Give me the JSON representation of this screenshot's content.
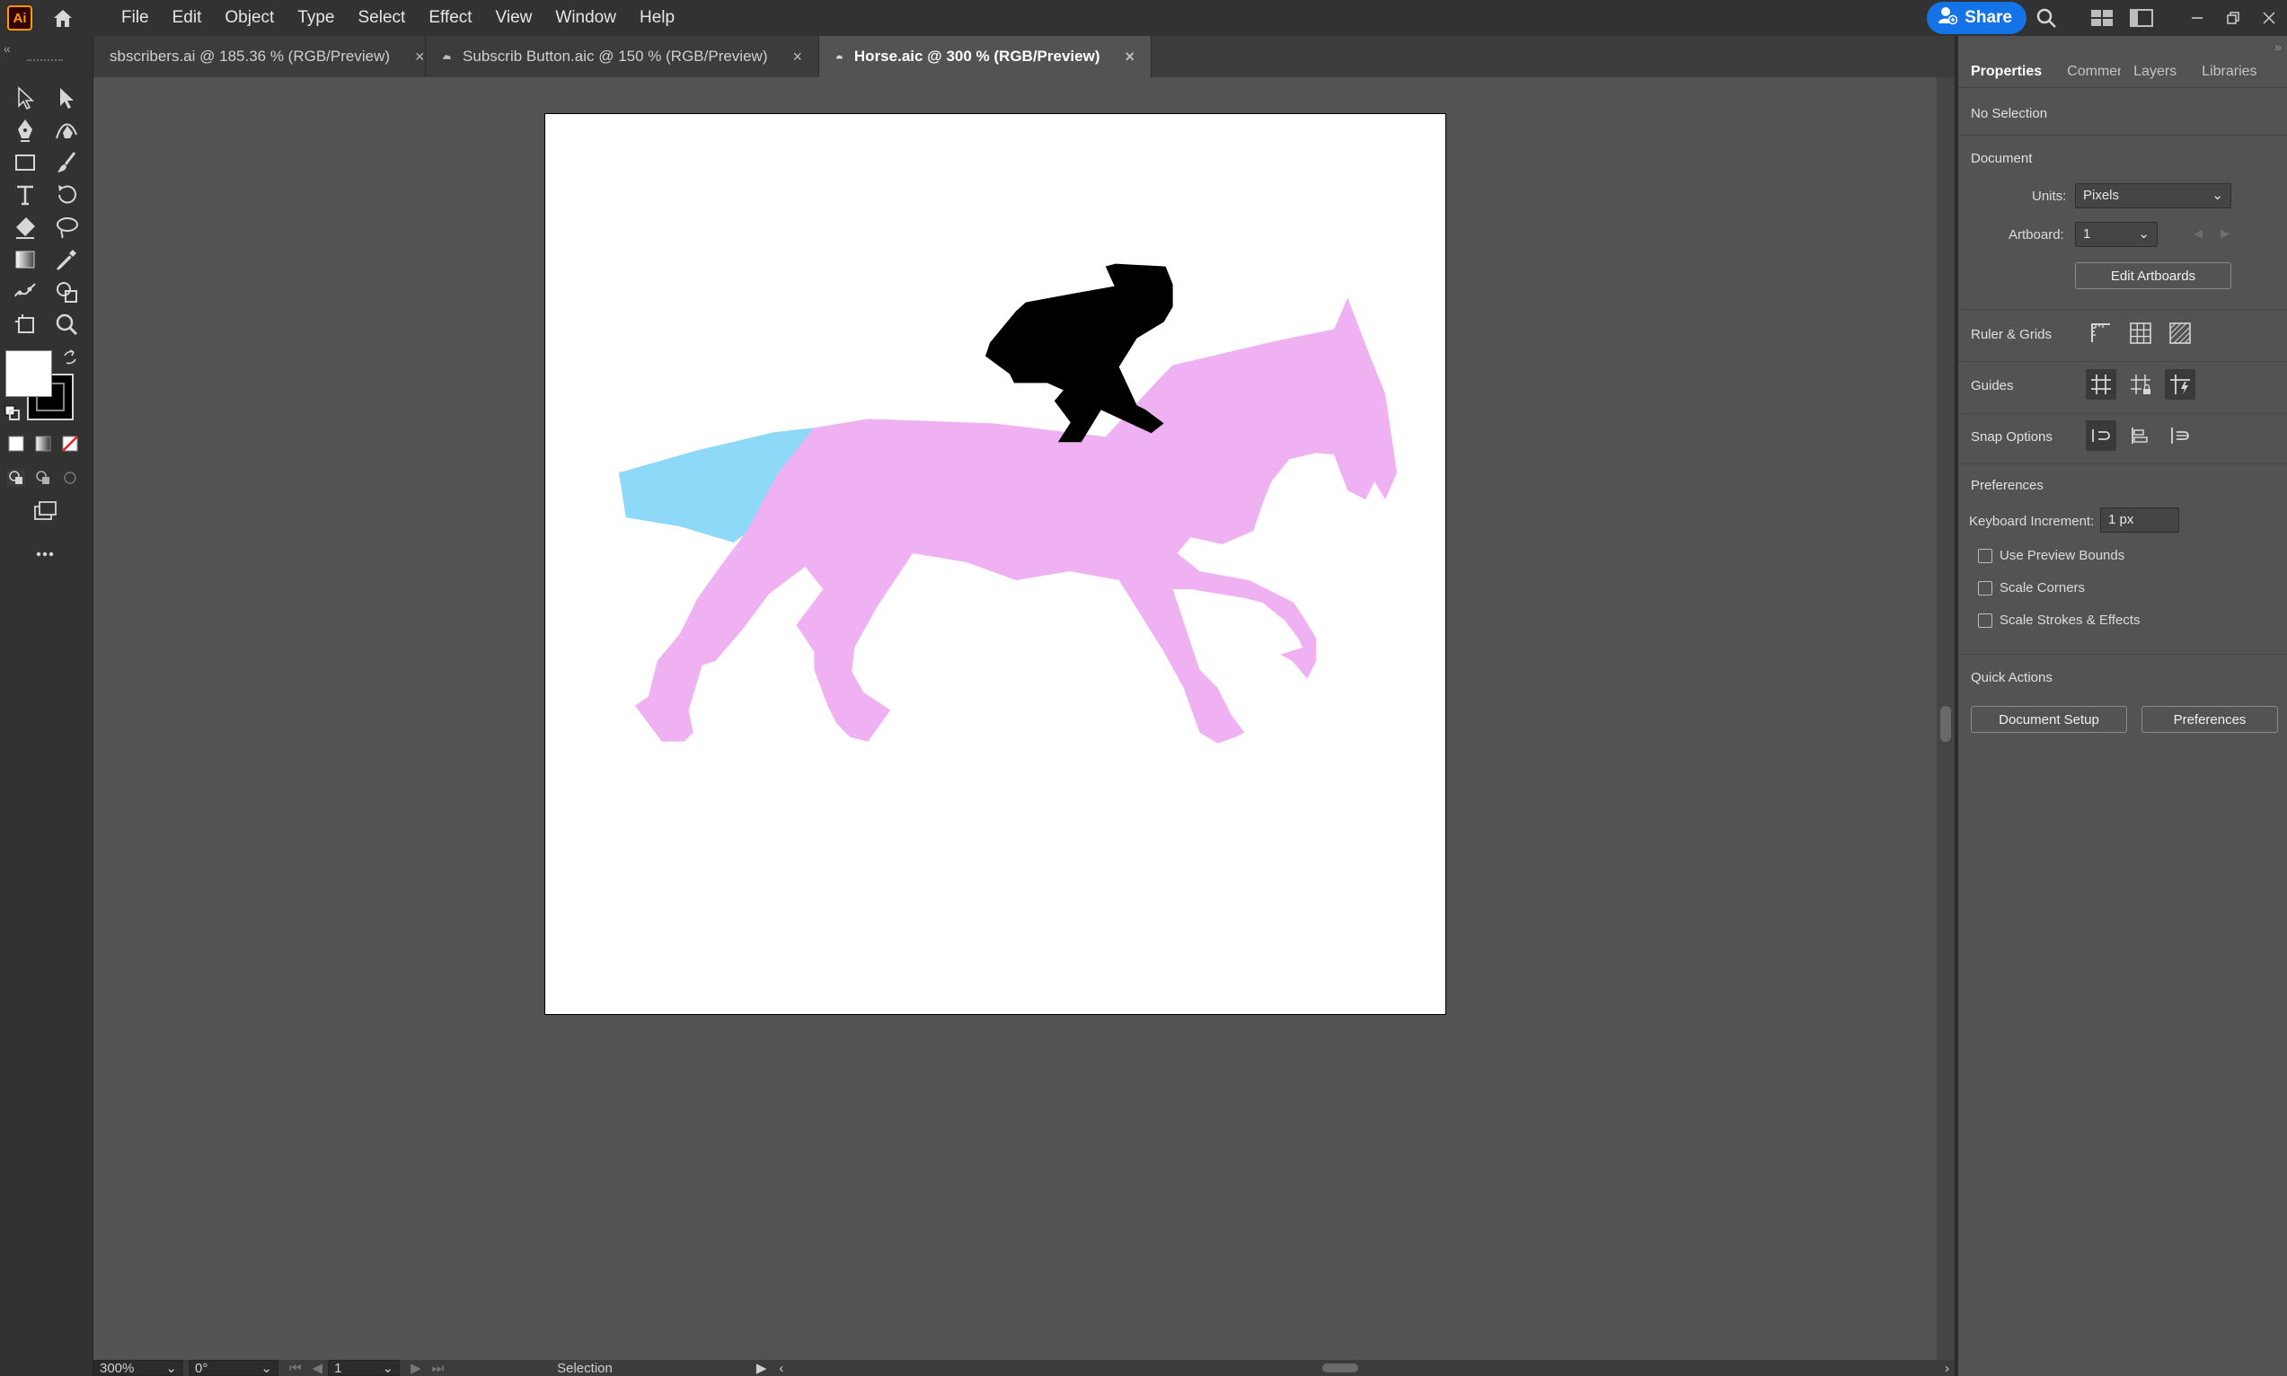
{
  "app": {
    "logo": "Ai"
  },
  "menu": [
    "File",
    "Edit",
    "Object",
    "Type",
    "Select",
    "Effect",
    "View",
    "Window",
    "Help"
  ],
  "share_label": "Share",
  "tabs": [
    {
      "title": "sbscribers.ai @ 185.36 % (RGB/Preview)",
      "cloud": false,
      "active": false
    },
    {
      "title": "Subscrib Button.aic @ 150 % (RGB/Preview)",
      "cloud": true,
      "active": false
    },
    {
      "title": "Horse.aic @ 300 % (RGB/Preview)",
      "cloud": true,
      "active": true
    }
  ],
  "close_glyph": "×",
  "colors": {
    "horse": "#f0b1f2",
    "tail": "#8ed9f8",
    "rider": "#000000",
    "accent": "#1473e6"
  },
  "panel": {
    "tabs": [
      "Properties",
      "Comment",
      "Layers",
      "Libraries"
    ],
    "selection": "No Selection",
    "document_heading": "Document",
    "units_label": "Units:",
    "units_value": "Pixels",
    "artboard_label": "Artboard:",
    "artboard_value": "1",
    "edit_artboards": "Edit Artboards",
    "ruler_grids": "Ruler & Grids",
    "guides": "Guides",
    "snap_options": "Snap Options",
    "preferences_heading": "Preferences",
    "keyboard_increment_label": "Keyboard Increment:",
    "keyboard_increment_value": "1 px",
    "checkboxes": [
      "Use Preview Bounds",
      "Scale Corners",
      "Scale Strokes & Effects"
    ],
    "quick_actions": "Quick Actions",
    "document_setup": "Document Setup",
    "preferences_button": "Preferences"
  },
  "status": {
    "zoom": "300%",
    "rotation": "0°",
    "artboard": "1",
    "tool": "Selection"
  }
}
